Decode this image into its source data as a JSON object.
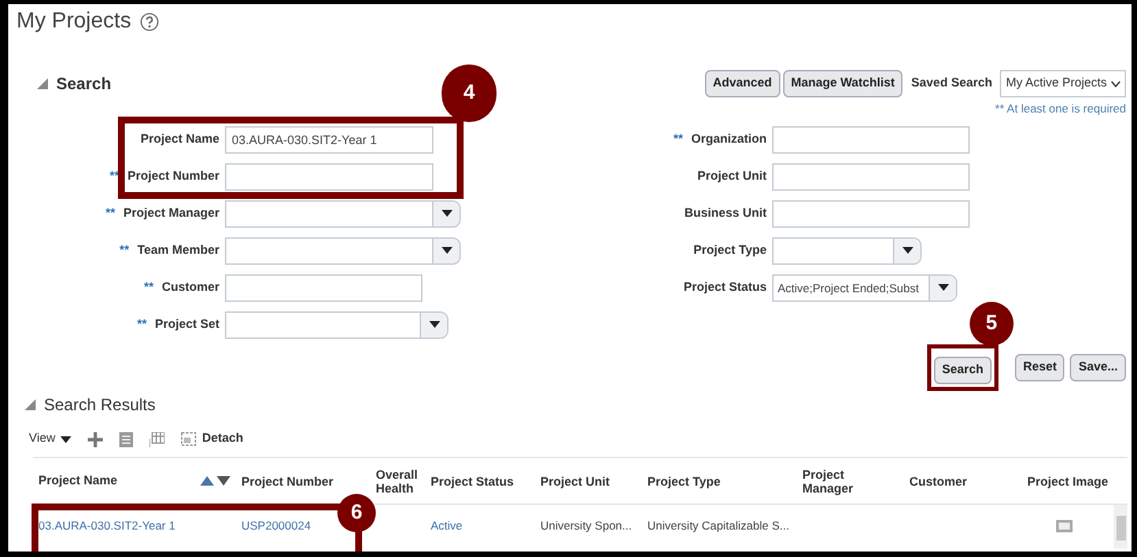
{
  "page_title": "My Projects",
  "search": {
    "title": "Search",
    "expanded": true,
    "buttons": [
      "Advanced",
      "Manage Watchlist"
    ],
    "saved_search": {
      "label": "Saved Search",
      "value": "My Active Projects"
    },
    "required_note": "** At least one is required",
    "left_fields": [
      {
        "label": "Project Name",
        "kind": "text",
        "value": "03.AURA-030.SIT2-Year 1"
      },
      {
        "label": "Project Number",
        "kind": "text",
        "marker": "**"
      },
      {
        "label": "Project Manager",
        "kind": "select",
        "marker": "**"
      },
      {
        "label": "Team Member",
        "kind": "select",
        "marker": "**"
      },
      {
        "label": "Customer",
        "kind": "text",
        "marker": "**"
      },
      {
        "label": "Project Set",
        "kind": "select",
        "marker": "**"
      }
    ],
    "right_fields": [
      {
        "label": "Organization",
        "kind": "text",
        "marker": "**"
      },
      {
        "label": "Project Unit",
        "kind": "text"
      },
      {
        "label": "Business Unit",
        "kind": "text"
      },
      {
        "label": "Project Type",
        "kind": "select"
      },
      {
        "label": "Project Status",
        "kind": "select",
        "value": "Active;Project Ended;Subst"
      }
    ],
    "actions": [
      "Search",
      "Reset",
      "Save..."
    ]
  },
  "results": {
    "title": "Search Results",
    "expanded": true,
    "toolbar": {
      "view": "View",
      "detach": "Detach"
    },
    "columns": [
      "Project Name",
      "Project Number",
      "Overall Health",
      "Project Status",
      "Project Unit",
      "Project Type",
      "Project Manager",
      "Customer",
      "Project Image"
    ],
    "rows": [
      {
        "cells": [
          "03.AURA-030.SIT2-Year 1",
          "USP2000024",
          "",
          "Active",
          "University Spon...",
          "University Capitalizable S...",
          "",
          "",
          ""
        ],
        "has_image": true
      }
    ]
  },
  "callouts": [
    "4",
    "5",
    "6"
  ]
}
